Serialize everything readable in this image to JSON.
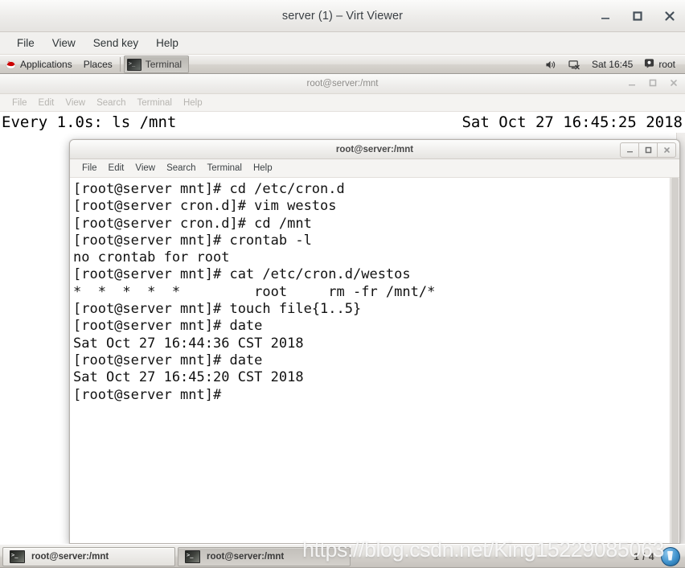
{
  "viewer": {
    "title": "server (1) – Virt Viewer",
    "menus": [
      "File",
      "View",
      "Send key",
      "Help"
    ],
    "window_buttons": [
      "minimize",
      "maximize",
      "close"
    ]
  },
  "gnome_panel": {
    "applications_label": "Applications",
    "places_label": "Places",
    "window_task_label": "Terminal",
    "volume_icon": "volume-icon",
    "network_icon": "network-disconnected-icon",
    "clock": "Sat 16:45",
    "user_icon": "user-icon",
    "user_label": "root"
  },
  "background_window": {
    "title": "root@server:/mnt",
    "menus": [
      "File",
      "Edit",
      "View",
      "Search",
      "Terminal",
      "Help"
    ],
    "watch_left": "Every 1.0s: ls /mnt",
    "watch_right": "Sat Oct 27 16:45:25 2018"
  },
  "foreground_window": {
    "title": "root@server:/mnt",
    "menus": [
      "File",
      "Edit",
      "View",
      "Search",
      "Terminal",
      "Help"
    ],
    "lines": [
      "[root@server mnt]# cd /etc/cron.d",
      "[root@server cron.d]# vim westos",
      "[root@server cron.d]# cd /mnt",
      "[root@server mnt]# crontab -l",
      "no crontab for root",
      "[root@server mnt]# cat /etc/cron.d/westos",
      "*  *  *  *  *         root     rm -fr /mnt/*",
      "[root@server mnt]# touch file{1..5}",
      "[root@server mnt]# date",
      "Sat Oct 27 16:44:36 CST 2018",
      "[root@server mnt]# date",
      "Sat Oct 27 16:45:20 CST 2018",
      "[root@server mnt]#"
    ]
  },
  "taskbar": {
    "items": [
      {
        "label": "root@server:/mnt",
        "state": "active"
      },
      {
        "label": "root@server:/mnt",
        "state": "inactive"
      }
    ],
    "workspace_indicator": "1 / 4",
    "trash_icon": "trash-icon"
  },
  "watermark": {
    "text": "https://blog.csdn.net/King15229085063"
  },
  "colors": {
    "panel_bg": "#e3e1dd",
    "titlebar_bg": "#edecea",
    "terminal_bg": "#ffffff",
    "terminal_fg": "#111111",
    "redhat_red": "#cc0000"
  }
}
